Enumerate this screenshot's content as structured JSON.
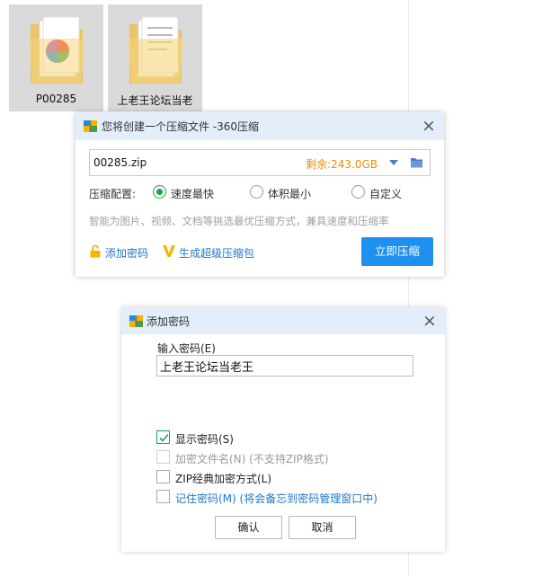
{
  "desktop": {
    "folders": [
      {
        "name": "P00285"
      },
      {
        "name": "上老王论坛当老"
      }
    ]
  },
  "compress_dialog": {
    "title": "您将创建一个压缩文件 -360压缩",
    "filename": "00285.zip",
    "remaining": "剩余:243.0GB",
    "config_label": "压缩配置:",
    "options": [
      {
        "label": "速度最快",
        "checked": true
      },
      {
        "label": "体积最小",
        "checked": false
      },
      {
        "label": "自定义",
        "checked": false
      }
    ],
    "hint": "智能为图片、视频、文档等挑选最优压缩方式，兼具速度和压缩率",
    "add_password_link": "添加密码",
    "super_pack_link": "生成超级压缩包",
    "compress_button": "立即压缩"
  },
  "password_dialog": {
    "title": "添加密码",
    "input_label": "输入密码(E)",
    "password_value": "上老王论坛当老王",
    "checkboxes": [
      {
        "label": "显示密码(S)",
        "checked": true,
        "disabled": false
      },
      {
        "label": "加密文件名(N) (不支持ZIP格式)",
        "checked": false,
        "disabled": true
      },
      {
        "label": "ZIP经典加密方式(L)",
        "checked": false,
        "disabled": false
      },
      {
        "label": "记住密码(M) (将会备忘到密码管理窗口中)",
        "checked": false,
        "disabled": false
      }
    ],
    "ok_button": "确认",
    "cancel_button": "取消"
  },
  "colors": {
    "accent": "#1e90f0",
    "link": "#1e78c8",
    "radio_green": "#1aa24a",
    "remaining_orange": "#f08c00",
    "titlebar": "#e3eefa"
  }
}
